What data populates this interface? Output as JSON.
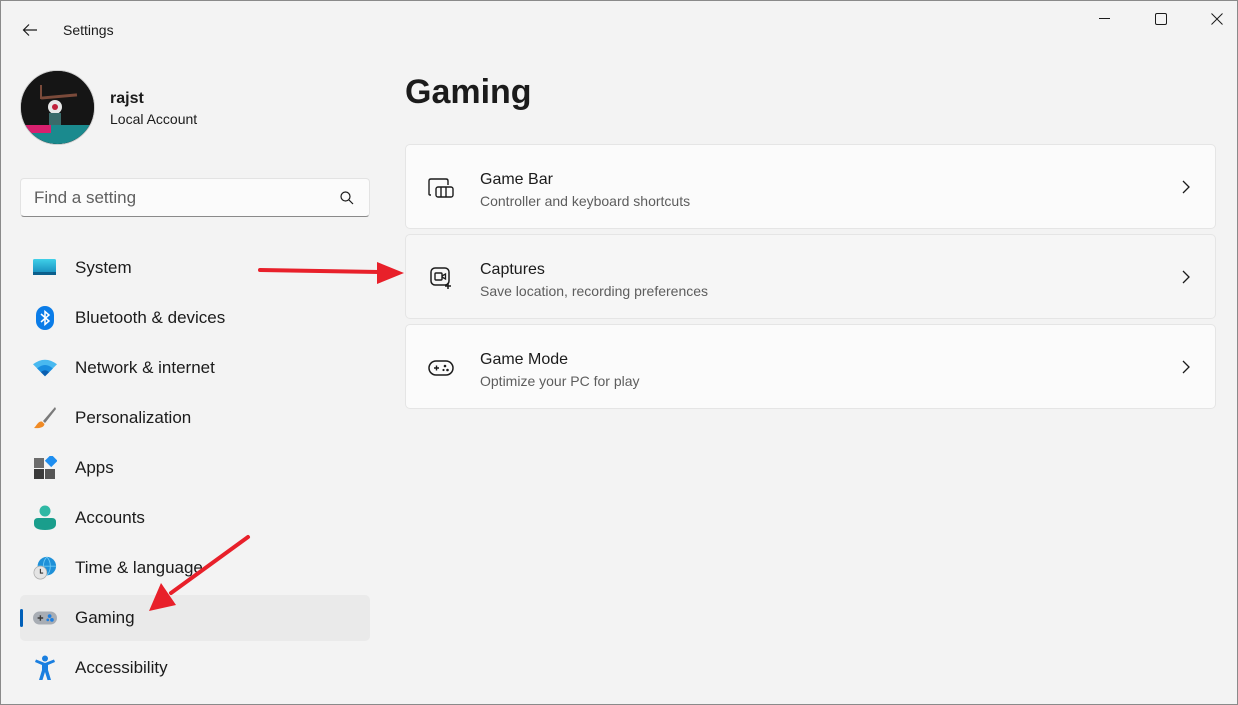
{
  "window": {
    "title": "Settings",
    "controls": {
      "minimize": "minimize",
      "maximize": "maximize",
      "close": "close"
    }
  },
  "profile": {
    "name": "rajst",
    "account_type": "Local Account"
  },
  "search": {
    "placeholder": "Find a setting",
    "value": ""
  },
  "sidebar": {
    "items": [
      {
        "label": "System",
        "icon": "system-icon",
        "active": false
      },
      {
        "label": "Bluetooth & devices",
        "icon": "bluetooth-icon",
        "active": false
      },
      {
        "label": "Network & internet",
        "icon": "wifi-icon",
        "active": false
      },
      {
        "label": "Personalization",
        "icon": "paintbrush-icon",
        "active": false
      },
      {
        "label": "Apps",
        "icon": "apps-icon",
        "active": false
      },
      {
        "label": "Accounts",
        "icon": "person-icon",
        "active": false
      },
      {
        "label": "Time & language",
        "icon": "globe-clock-icon",
        "active": false
      },
      {
        "label": "Gaming",
        "icon": "gamepad-icon",
        "active": true
      },
      {
        "label": "Accessibility",
        "icon": "accessibility-icon",
        "active": false
      }
    ]
  },
  "main": {
    "title": "Gaming",
    "cards": [
      {
        "title": "Game Bar",
        "description": "Controller and keyboard shortcuts",
        "icon": "game-bar-icon"
      },
      {
        "title": "Captures",
        "description": "Save location, recording preferences",
        "icon": "capture-icon"
      },
      {
        "title": "Game Mode",
        "description": "Optimize your PC for play",
        "icon": "game-mode-icon"
      }
    ]
  },
  "colors": {
    "accent": "#005fb8",
    "annotation_arrow": "#e8202a",
    "background": "#f3f3f3",
    "card": "#fbfbfb"
  }
}
